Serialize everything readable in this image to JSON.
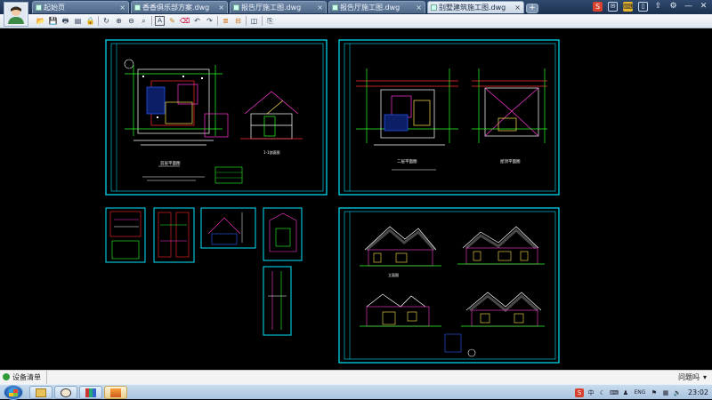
{
  "titlebar": {
    "tabs": [
      {
        "label": "起始页",
        "active": false
      },
      {
        "label": "香香俱乐部方案.dwg",
        "active": false
      },
      {
        "label": "报告厅施工图.dwg",
        "active": false
      },
      {
        "label": "报告厅施工图.dwg",
        "active": false
      },
      {
        "label": "别墅建筑施工图.dwg",
        "active": true
      }
    ],
    "new_tab_label": "+",
    "right_icons": [
      "sogou-s-icon",
      "message-icon",
      "keyboard-icon",
      "phone-icon",
      "share-icon",
      "settings-icon",
      "minimize-icon",
      "close-icon"
    ]
  },
  "toolbar": {
    "icons": [
      "open-icon",
      "save-icon",
      "print-icon",
      "print-preview-icon",
      "lock-icon",
      "sep",
      "rotate-icon",
      "zoom-in-icon",
      "zoom-out-icon",
      "zoom-window-icon",
      "sep",
      "text-icon",
      "pencil-icon",
      "erase-icon",
      "undo-icon",
      "redo-icon",
      "sep",
      "layer-icon",
      "measure-icon",
      "sep",
      "layers-stack-icon",
      "sep",
      "export-icon"
    ]
  },
  "drawing": {
    "sheet_labels": [
      "首层平面图",
      "二层平面图",
      "屋顶平面图",
      "立面图",
      "1-1剖面图"
    ]
  },
  "statusbar": {
    "device_list": "设备清单",
    "help": "问题吗",
    "colors": {
      "bg": "#f3f3f3",
      "ok": "#2f9a3a"
    }
  },
  "taskbar": {
    "clock": "23:02",
    "tray_labels": [
      "S",
      "中",
      "ENG"
    ],
    "buttons": [
      "explorer-icon",
      "qq-icon",
      "books-icon",
      "cad-viewer-icon"
    ]
  },
  "colors": {
    "cad_background": "#000000",
    "frame": "#00e5ff",
    "lines_white": "#ffffff",
    "lines_red": "#ff2a2a",
    "lines_green": "#2bff2b",
    "lines_magenta": "#ff3bd6",
    "lines_blue": "#2a5bff",
    "lines_yellow": "#ffe34d"
  }
}
